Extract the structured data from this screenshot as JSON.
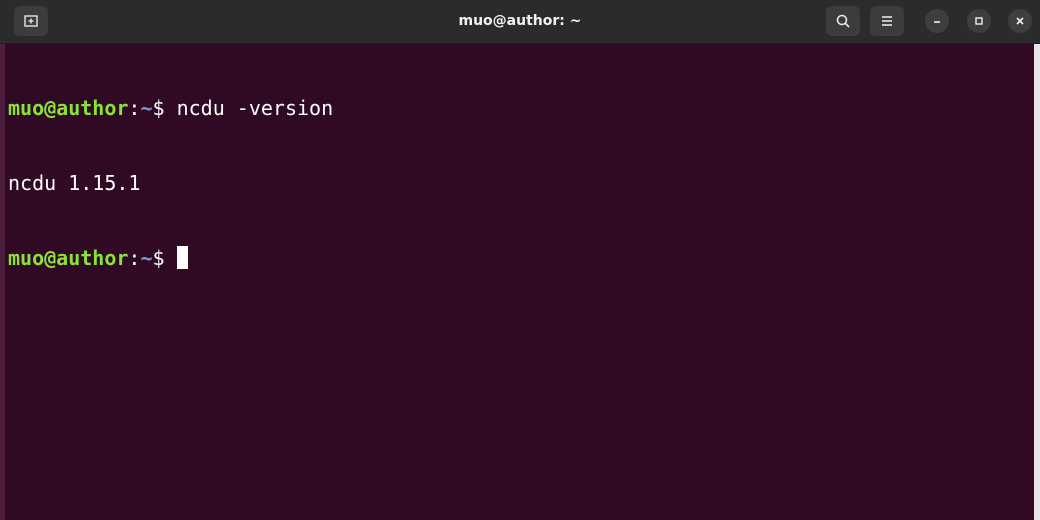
{
  "window": {
    "title": "muo@author: ~"
  },
  "colors": {
    "background": "#300a24",
    "titlebar": "#2b2b2b",
    "prompt_user": "#8ae234",
    "prompt_path": "#729fcf",
    "text": "#ffffff"
  },
  "toolbar": {
    "new_tab_icon": "new-tab-icon",
    "search_icon": "search-icon",
    "menu_icon": "hamburger-menu-icon"
  },
  "window_controls": {
    "minimize_icon": "minimize-icon",
    "maximize_icon": "maximize-icon",
    "close_icon": "close-icon"
  },
  "terminal": {
    "lines": [
      {
        "type": "prompt",
        "user_host": "muo@author",
        "colon": ":",
        "path": "~",
        "symbol": "$",
        "command": " ncdu -version"
      },
      {
        "type": "output",
        "text": "ncdu 1.15.1"
      },
      {
        "type": "prompt",
        "user_host": "muo@author",
        "colon": ":",
        "path": "~",
        "symbol": "$",
        "command": " "
      }
    ]
  }
}
